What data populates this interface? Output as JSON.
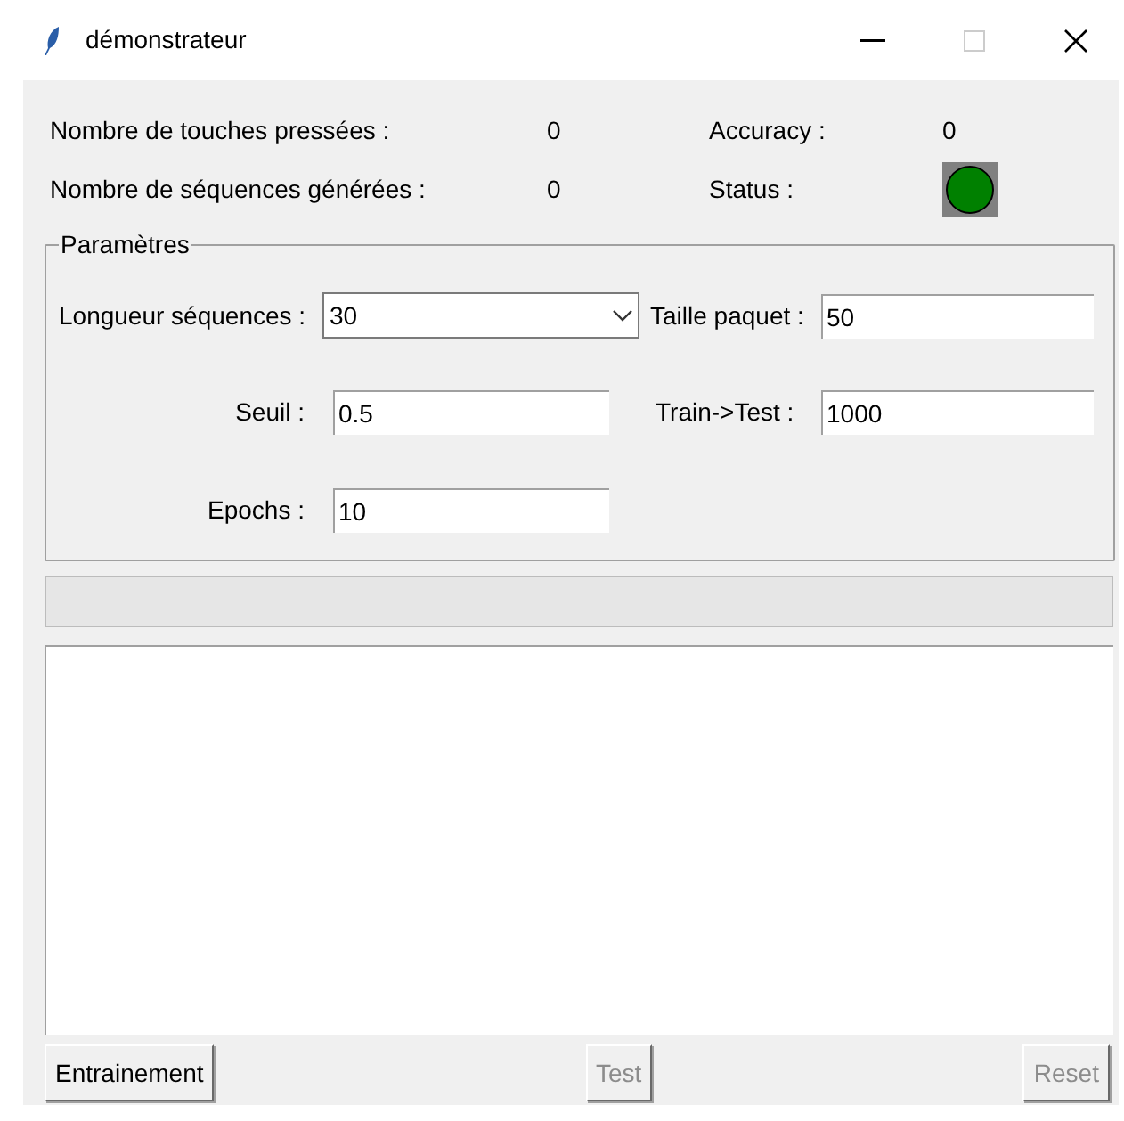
{
  "window": {
    "title": "démonstrateur"
  },
  "stats": [
    {
      "label": "Nombre de touches pressées :",
      "value": "0",
      "label_2": "Accuracy :",
      "value_2": "0",
      "kind": "text"
    },
    {
      "label": "Nombre de séquences générées :",
      "value": "0",
      "label_2": "Status :",
      "kind": "status",
      "color": "#008000"
    }
  ],
  "parameters": {
    "title": "Paramètres",
    "sequence_length": {
      "label": "Longueur séquences :",
      "value": "30"
    },
    "batch_size": {
      "label": "Taille paquet :",
      "value": "50"
    },
    "threshold": {
      "label": "Seuil :",
      "value": "0.5"
    },
    "train_test": {
      "label": "Train->Test :",
      "value": "1000"
    },
    "epochs": {
      "label": "Epochs :",
      "value": "10"
    }
  },
  "progress": {
    "level": 0
  },
  "buttons": [
    {
      "label": "Entrainement",
      "disabled": false
    },
    {
      "label": "Test",
      "disabled": true
    },
    {
      "label": "Reset",
      "disabled": true
    }
  ]
}
